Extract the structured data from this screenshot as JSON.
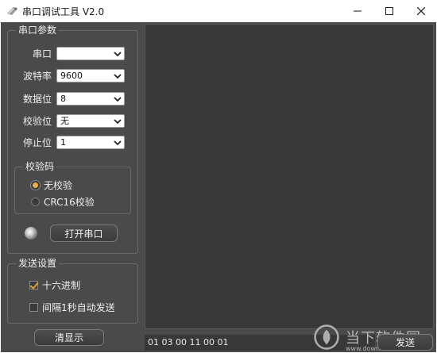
{
  "window": {
    "title": "串口调试工具 V2.0"
  },
  "serial_params": {
    "title": "串口参数",
    "port": {
      "label": "串口",
      "value": ""
    },
    "baud": {
      "label": "波特率",
      "value": "9600"
    },
    "data_bits": {
      "label": "数据位",
      "value": "8"
    },
    "parity": {
      "label": "校验位",
      "value": "无"
    },
    "stop_bits": {
      "label": "停止位",
      "value": "1"
    }
  },
  "checksum": {
    "title": "校验码",
    "options": [
      {
        "label": "无校验",
        "selected": true
      },
      {
        "label": "CRC16校验",
        "selected": false
      }
    ]
  },
  "port_control": {
    "open_label": "打开串口"
  },
  "send_settings": {
    "title": "发送设置",
    "hex": {
      "label": "十六进制",
      "checked": true
    },
    "auto_send": {
      "label": "间隔1秒自动发送",
      "checked": false
    }
  },
  "actions": {
    "clear_label": "清显示",
    "send_label": "发送"
  },
  "send_input": {
    "value": "01 03 00 11 00 01"
  },
  "watermark": {
    "text": "当下软件园",
    "sub": "www.downxia.com"
  },
  "colors": {
    "background": "#4a4a4a",
    "panel": "#383838",
    "accent": "#e8b04a"
  }
}
